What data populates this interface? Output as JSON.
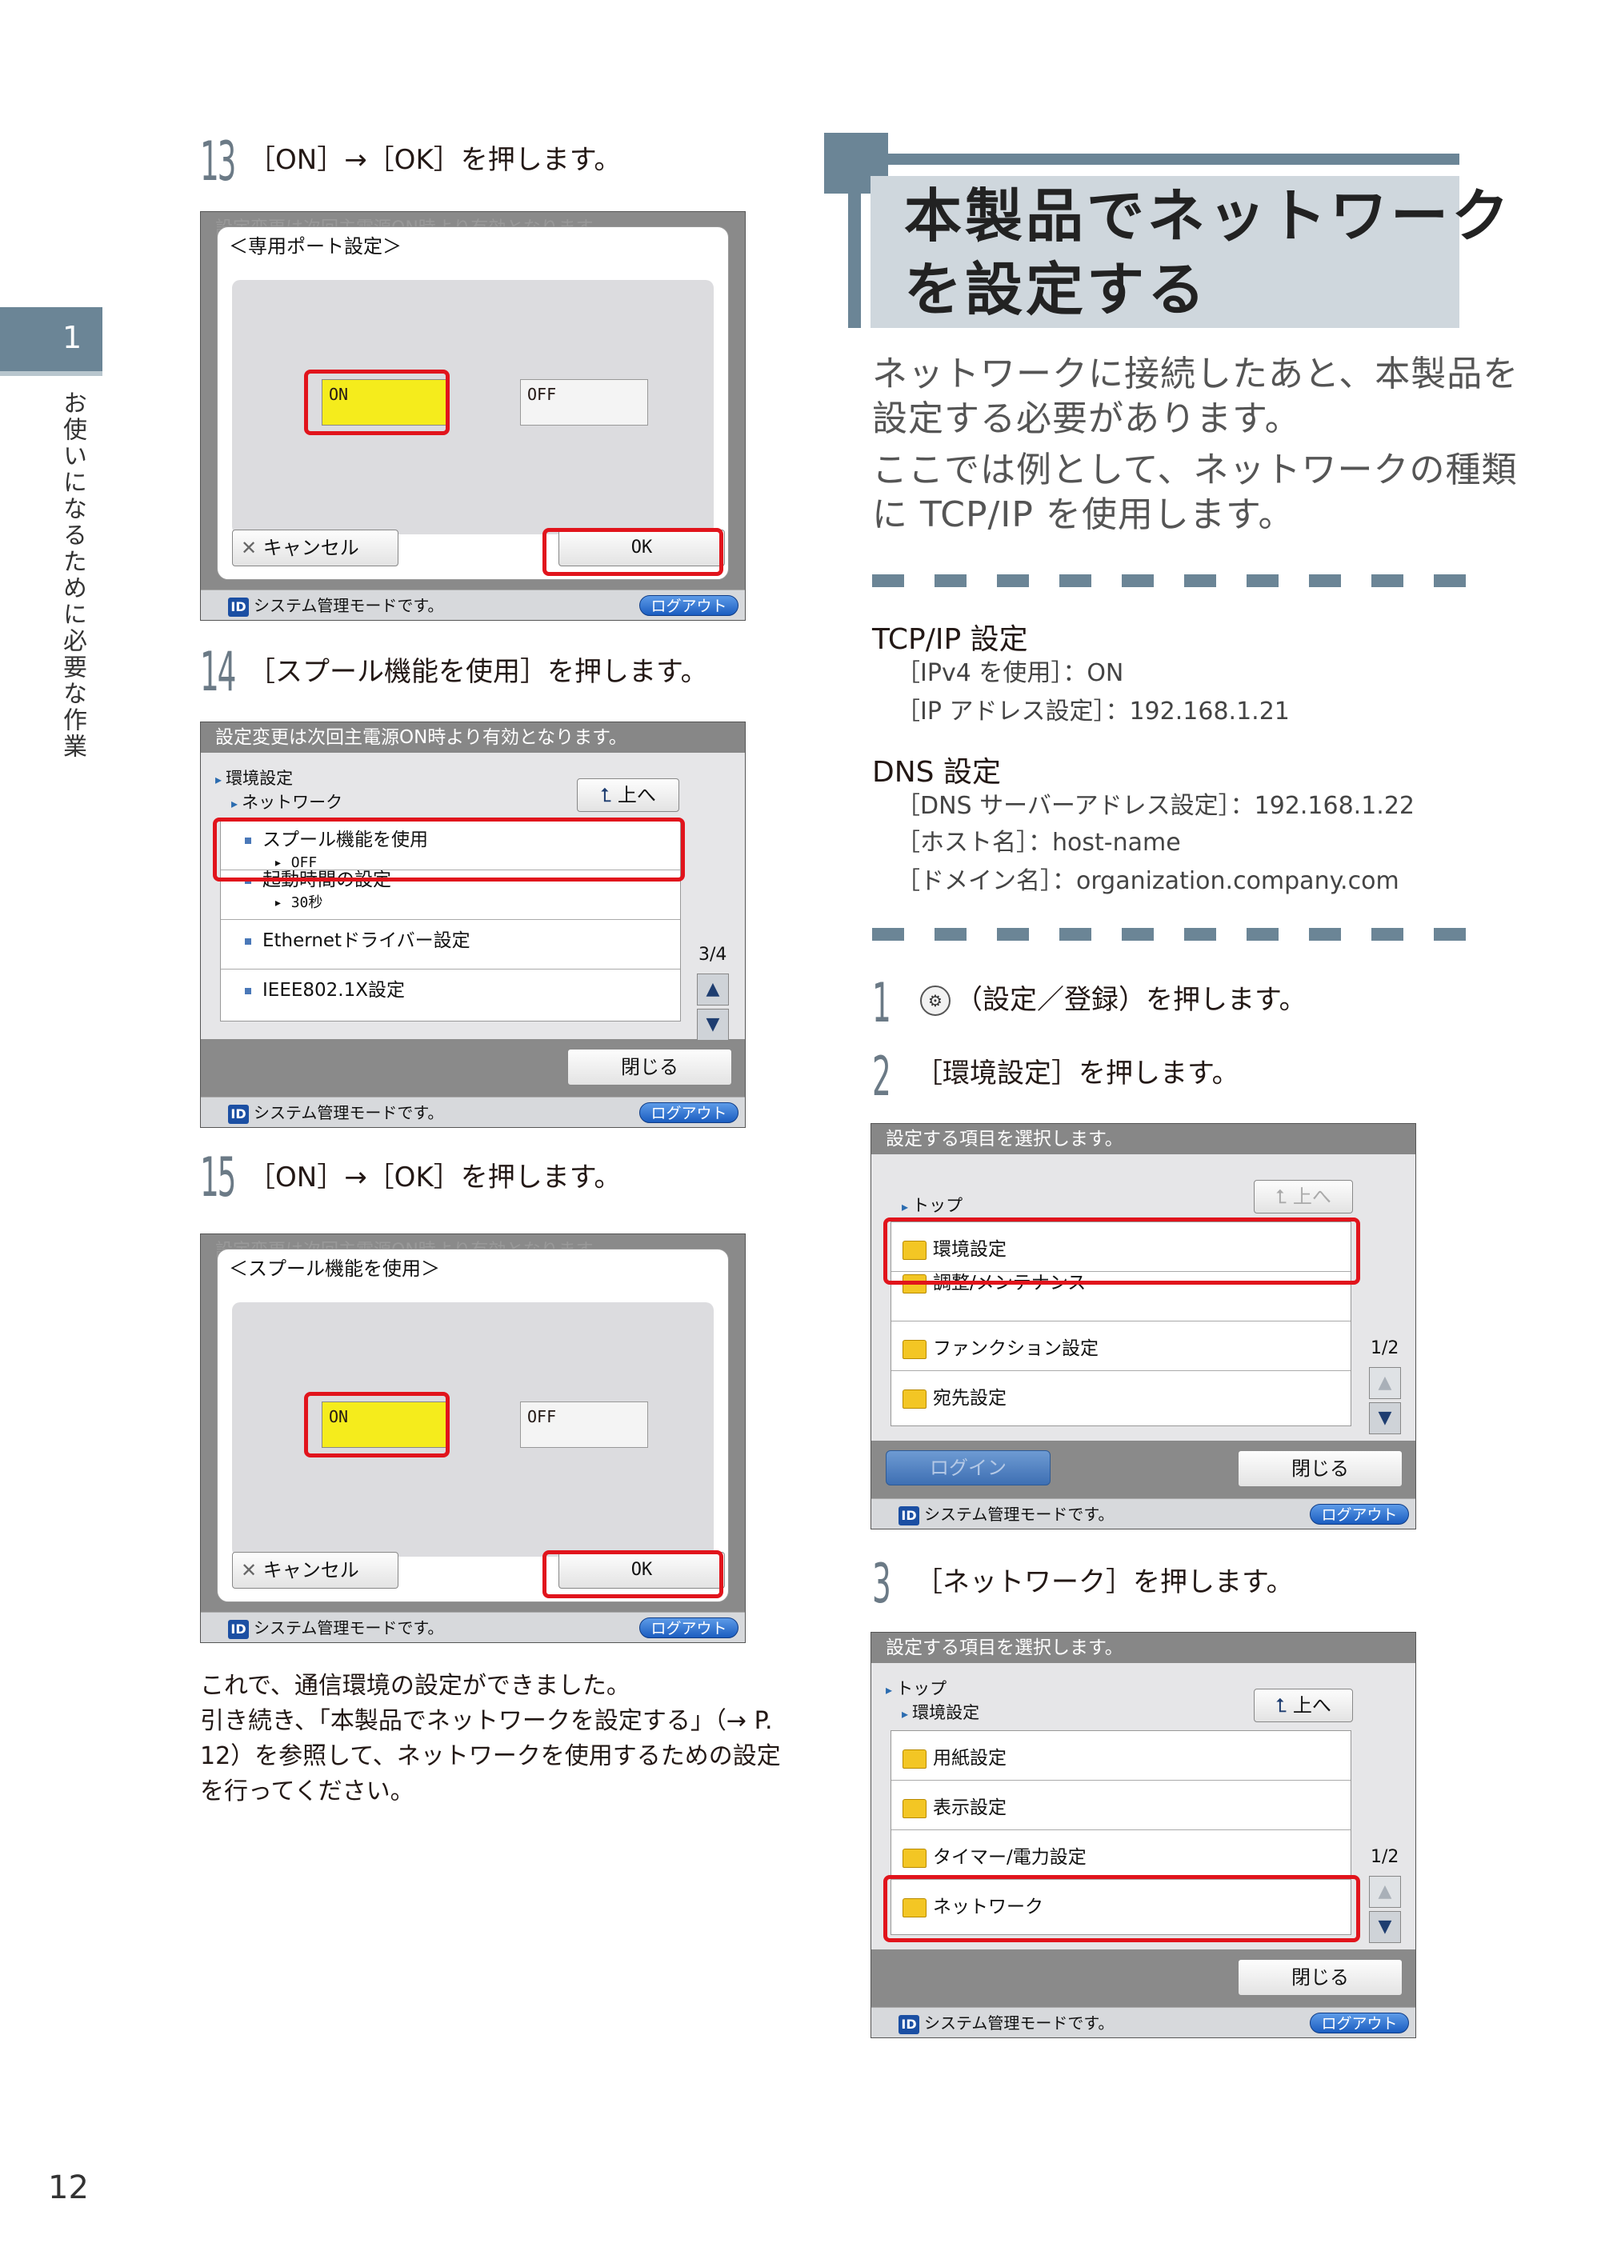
{
  "side": {
    "chapter_number": "1",
    "chapter_title": "お使いになるために必要な作業",
    "page_number": "12"
  },
  "steps": {
    "s13": {
      "num": "13",
      "text": "［ON］→［OK］を押します。"
    },
    "s14": {
      "num": "14",
      "text": "［スプール機能を使用］を押します。"
    },
    "s15": {
      "num": "15",
      "text": "［ON］→［OK］を押します。"
    },
    "s1": {
      "num": "1",
      "text": "（設定／登録）を押します。"
    },
    "s2": {
      "num": "2",
      "text": "［環境設定］を押します。"
    },
    "s3": {
      "num": "3",
      "text": "［ネットワーク］を押します。"
    }
  },
  "screens": {
    "common": {
      "sys_mode": "システム管理モードです。",
      "logout": "ログアウト",
      "id_badge": "ID",
      "close": "閉じる",
      "up": "上へ"
    },
    "s13": {
      "faded_msg": "設定変更は次回主電源ON時より有効となります。",
      "title": "＜専用ポート設定＞",
      "on": "ON",
      "off": "OFF",
      "cancel": "キャンセル",
      "ok": "OK"
    },
    "s14": {
      "topbar": "設定変更は次回主電源ON時より有効となります。",
      "crumb1": "環境設定",
      "crumb2": "ネットワーク",
      "items": [
        {
          "label": "スプール機能を使用",
          "sub": "OFF"
        },
        {
          "label": "起動時間の設定",
          "sub": "30秒"
        },
        {
          "label": "Ethernetドライバー設定",
          "sub": ""
        },
        {
          "label": "IEEE802.1X設定",
          "sub": ""
        }
      ],
      "page": "3/4"
    },
    "s15": {
      "faded_msg": "設定変更は次回主電源ON時より有効となります。",
      "title": "＜スプール機能を使用＞",
      "on": "ON",
      "off": "OFF",
      "cancel": "キャンセル",
      "ok": "OK"
    },
    "s2": {
      "topbar": "設定する項目を選択します。",
      "crumb1": "トップ",
      "items": [
        "環境設定",
        "調整/メンテナンス",
        "ファンクション設定",
        "宛先設定"
      ],
      "page": "1/2",
      "login": "ログイン"
    },
    "s3": {
      "topbar": "設定する項目を選択します。",
      "crumb1": "トップ",
      "crumb2": "環境設定",
      "items": [
        "用紙設定",
        "表示設定",
        "タイマー/電力設定",
        "ネットワーク"
      ],
      "page": "1/2"
    }
  },
  "heading": {
    "line1": "本製品でネットワーク",
    "line2": "を設定する"
  },
  "intro": {
    "p1a": "ネットワークに接続したあと、本製品を",
    "p1b": "設定する必要があります。",
    "p2a": "ここでは例として、ネットワークの種類",
    "p2b": "に TCP/IP を使用します。"
  },
  "settings": {
    "tcpip_h": "TCP/IP 設定",
    "tcpip_1": "［IPv4 を使用］：ON",
    "tcpip_2": "［IP アドレス設定］：192.168.1.21",
    "dns_h": "DNS 設定",
    "dns_1": "［DNS サーバーアドレス設定］：192.168.1.22",
    "dns_2": "［ホスト名］：host-name",
    "dns_3": "［ドメイン名］：organization.company.com"
  },
  "closing": {
    "l1": "これで、通信環境の設定ができました。",
    "l2": "引き続き、「本製品でネットワークを設定する」（→ P.",
    "l3": "12）を参照して、ネットワークを使用するための設定",
    "l4": "を行ってください。"
  },
  "colors": {
    "accent": "#6b8596",
    "highlight": "#e1141c",
    "on_button": "#f5ec1c"
  }
}
